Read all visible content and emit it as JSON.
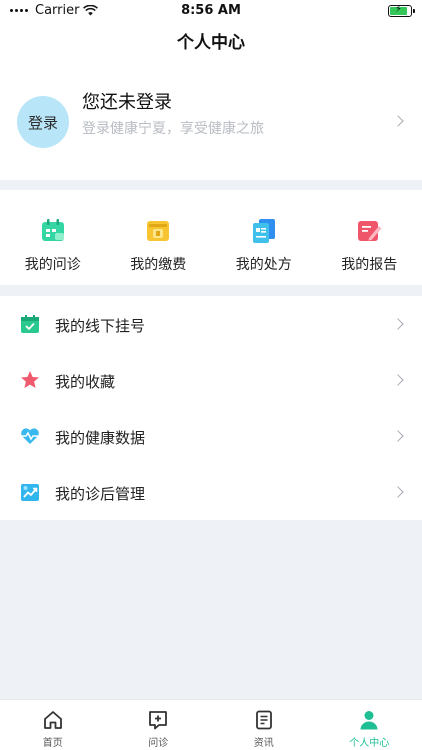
{
  "status_bar": {
    "carrier": "Carrier",
    "time": "8:56 AM"
  },
  "nav": {
    "title": "个人中心"
  },
  "profile": {
    "avatar_label": "登录",
    "name": "您还未登录",
    "subtitle": "登录健康宁夏，享受健康之旅"
  },
  "quick_actions": [
    {
      "label": "我的问诊",
      "icon": "consultation-icon"
    },
    {
      "label": "我的缴费",
      "icon": "payment-icon"
    },
    {
      "label": "我的处方",
      "icon": "prescription-icon"
    },
    {
      "label": "我的报告",
      "icon": "report-icon"
    }
  ],
  "menu": [
    {
      "label": "我的线下挂号",
      "icon": "calendar-check-icon"
    },
    {
      "label": "我的收藏",
      "icon": "star-icon"
    },
    {
      "label": "我的健康数据",
      "icon": "heart-pulse-icon"
    },
    {
      "label": "我的诊后管理",
      "icon": "trend-chart-icon"
    }
  ],
  "tabbar": {
    "items": [
      {
        "label": "首页",
        "icon": "home-icon"
      },
      {
        "label": "问诊",
        "icon": "medical-plus-icon"
      },
      {
        "label": "资讯",
        "icon": "news-icon"
      },
      {
        "label": "个人中心",
        "icon": "person-icon"
      }
    ],
    "active": "个人中心"
  },
  "colors": {
    "accent": "#1fbf95",
    "avatar_bg": "#b9e5f8",
    "page_bg": "#eef1f5",
    "muted_text": "#b8bcc3"
  }
}
